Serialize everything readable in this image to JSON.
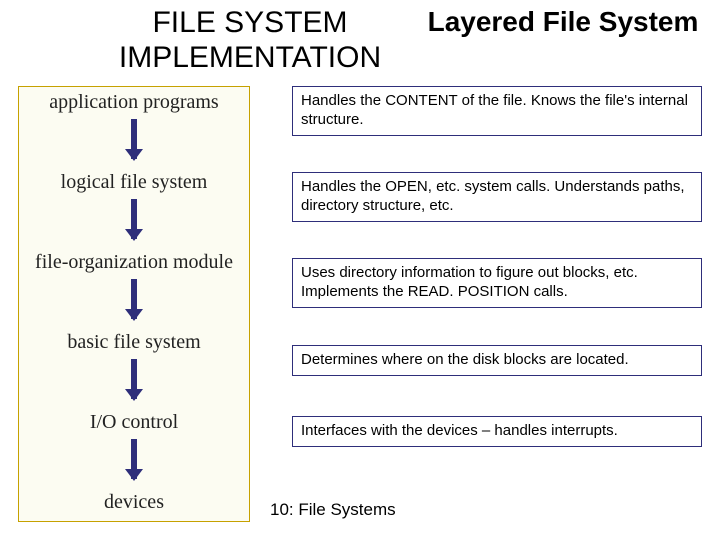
{
  "title_left": "FILE SYSTEM IMPLEMENTATION",
  "title_right": "Layered File System",
  "layers": [
    {
      "label": "application programs"
    },
    {
      "label": "logical file system"
    },
    {
      "label": "file-organization module"
    },
    {
      "label": "basic file system"
    },
    {
      "label": "I/O control"
    },
    {
      "label": "devices"
    }
  ],
  "descriptions": [
    "Handles the CONTENT of the file.  Knows the file's internal structure.",
    "Handles the OPEN, etc. system calls.  Understands paths, directory structure, etc.",
    "Uses directory information to figure out blocks, etc.  Implements the READ. POSITION calls.",
    "Determines where on the disk blocks are located.",
    "Interfaces with the devices – handles interrupts."
  ],
  "footer": "10: File Systems",
  "chart_data": {
    "type": "diagram",
    "title": "Layered File System",
    "nodes": [
      "application programs",
      "logical file system",
      "file-organization module",
      "basic file system",
      "I/O control",
      "devices"
    ],
    "edges": [
      {
        "from": "application programs",
        "to": "logical file system",
        "direction": "down"
      },
      {
        "from": "logical file system",
        "to": "file-organization module",
        "direction": "down"
      },
      {
        "from": "file-organization module",
        "to": "basic file system",
        "direction": "down"
      },
      {
        "from": "basic file system",
        "to": "I/O control",
        "direction": "down"
      },
      {
        "from": "I/O control",
        "to": "devices",
        "direction": "down"
      }
    ],
    "annotations": {
      "application programs": "Handles the CONTENT of the file.  Knows the file's internal structure.",
      "logical file system": "Handles the OPEN, etc. system calls.  Understands paths, directory structure, etc.",
      "file-organization module": "Uses directory information to figure out blocks, etc.  Implements the READ. POSITION calls.",
      "basic file system": "Determines where on the disk blocks are located.",
      "I/O control": "Interfaces with the devices – handles interrupts."
    }
  }
}
